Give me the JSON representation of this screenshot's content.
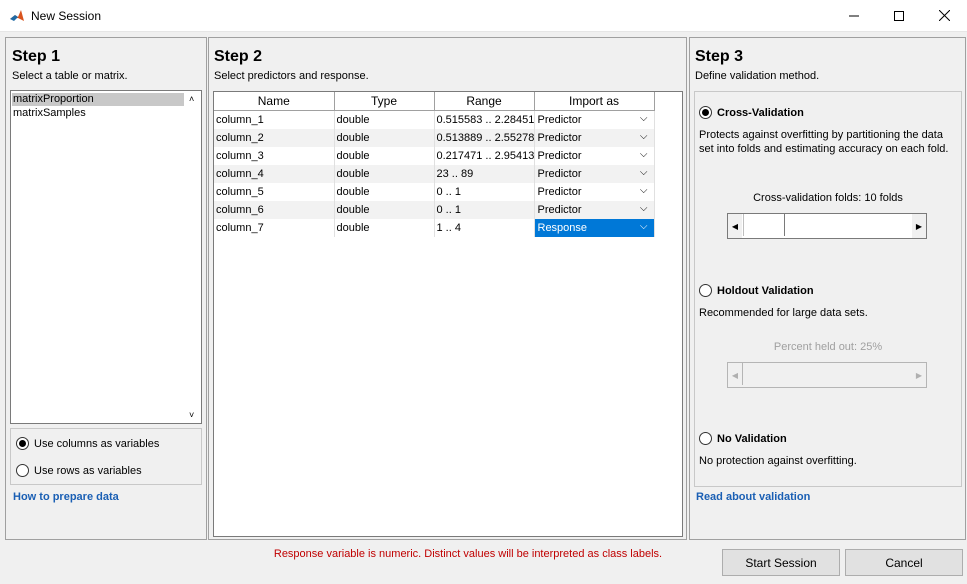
{
  "window": {
    "title": "New Session"
  },
  "step1": {
    "title": "Step 1",
    "subtitle": "Select a table or matrix.",
    "items": [
      "matrixProportion",
      "matrixSamples"
    ],
    "radio_columns": "Use columns as variables",
    "radio_rows": "Use rows as variables",
    "link": "How to prepare data"
  },
  "step2": {
    "title": "Step 2",
    "subtitle": "Select predictors and response.",
    "headers": [
      "Name",
      "Type",
      "Range",
      "Import as"
    ],
    "rows": [
      [
        "column_1",
        "double",
        "0.515583 .. 2.28451",
        "Predictor"
      ],
      [
        "column_2",
        "double",
        "0.513889 .. 2.55278",
        "Predictor"
      ],
      [
        "column_3",
        "double",
        "0.217471 .. 2.95413",
        "Predictor"
      ],
      [
        "column_4",
        "double",
        "23 .. 89",
        "Predictor"
      ],
      [
        "column_5",
        "double",
        "0 .. 1",
        "Predictor"
      ],
      [
        "column_6",
        "double",
        "0 .. 1",
        "Predictor"
      ],
      [
        "column_7",
        "double",
        "1 .. 4",
        "Response"
      ]
    ]
  },
  "step3": {
    "title": "Step 3",
    "subtitle": "Define validation method.",
    "cv_label": "Cross-Validation",
    "cv_desc": "Protects against overfitting by partitioning the data set into folds and estimating accuracy on each fold.",
    "cv_slider_label": "Cross-validation folds: 10 folds",
    "holdout_label": "Holdout Validation",
    "holdout_desc": "Recommended for large data sets.",
    "holdout_slider_label": "Percent held out: 25%",
    "none_label": "No Validation",
    "none_desc": "No protection against overfitting.",
    "link": "Read about validation"
  },
  "footer": {
    "message": "Response variable is numeric. Distinct values will be interpreted as class labels.",
    "start_button": "Start Session",
    "cancel_button": "Cancel"
  },
  "colors": {
    "selection": "#0078d7",
    "link": "#1a5fb4",
    "message": "#c00000"
  }
}
